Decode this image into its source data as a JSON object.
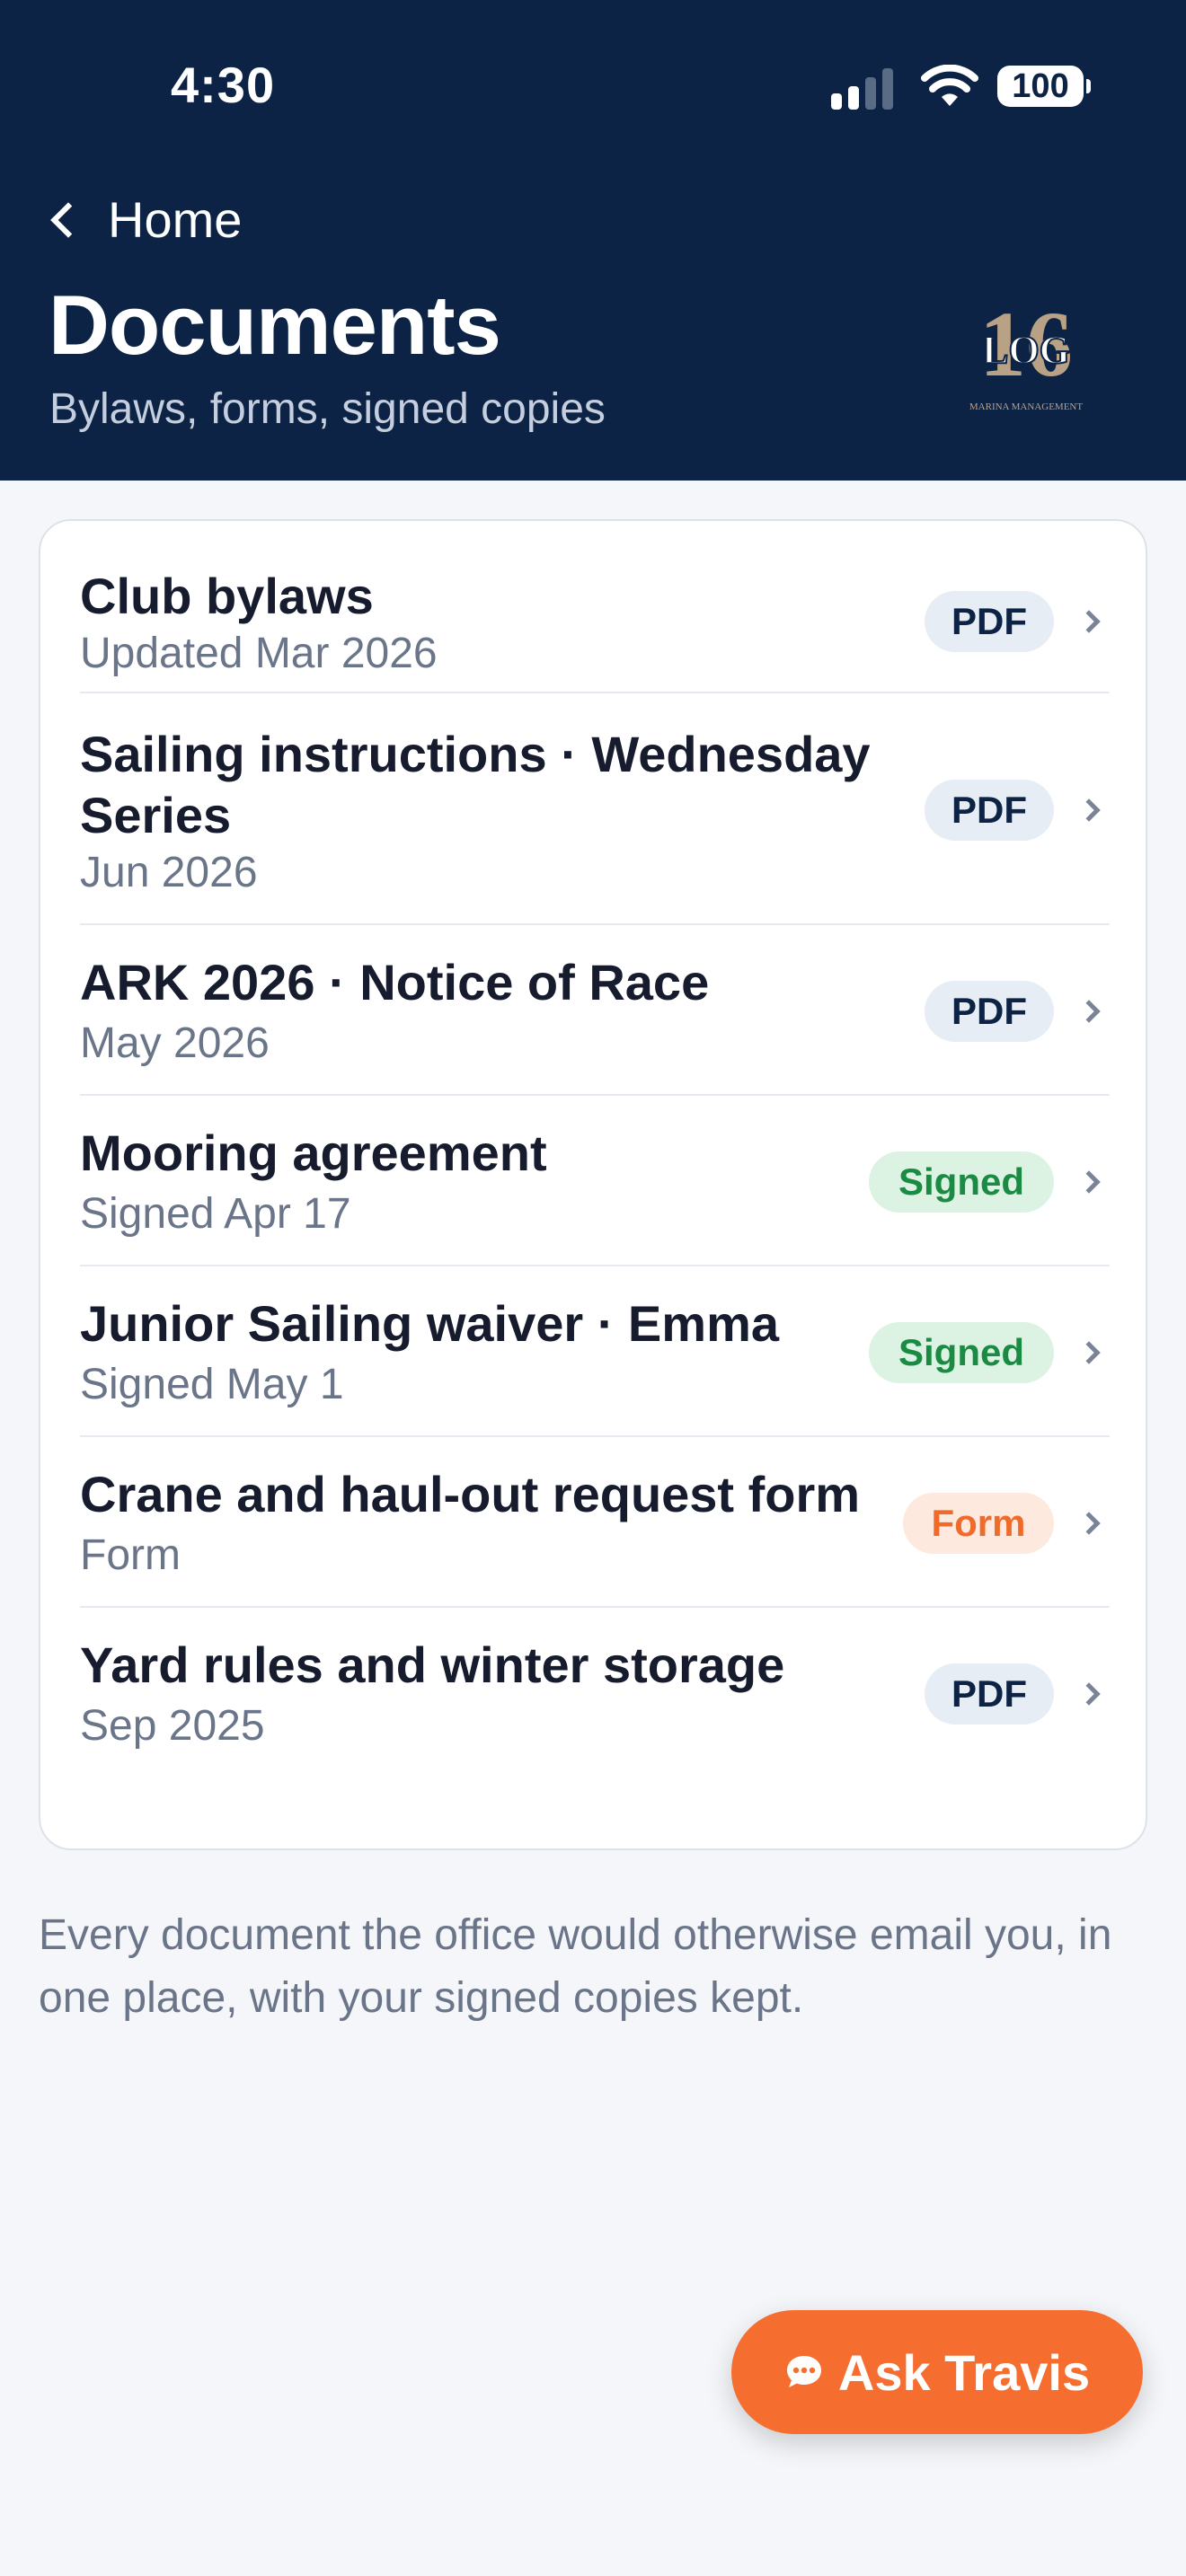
{
  "status_bar": {
    "time": "4:30",
    "battery": "100"
  },
  "header": {
    "back_label": "Home",
    "title": "Documents",
    "subtitle": "Bylaws, forms, signed copies",
    "logo": {
      "number": "16",
      "letters": "LOG",
      "tagline": "MARINA MANAGEMENT"
    }
  },
  "documents": [
    {
      "title": "Club bylaws",
      "sub": "Updated Mar 2026",
      "badge": "PDF",
      "badge_type": "pdf"
    },
    {
      "title": "Sailing instructions · Wednesday Series",
      "sub": "Jun 2026",
      "badge": "PDF",
      "badge_type": "pdf"
    },
    {
      "title": "ARK 2026 · Notice of Race",
      "sub": "May 2026",
      "badge": "PDF",
      "badge_type": "pdf"
    },
    {
      "title": "Mooring agreement",
      "sub": "Signed Apr 17",
      "badge": "Signed",
      "badge_type": "signed"
    },
    {
      "title": "Junior Sailing waiver · Emma",
      "sub": "Signed May 1",
      "badge": "Signed",
      "badge_type": "signed"
    },
    {
      "title": "Crane and haul-out request form",
      "sub": "Form",
      "badge": "Form",
      "badge_type": "form"
    },
    {
      "title": "Yard rules and winter storage",
      "sub": "Sep 2025",
      "badge": "PDF",
      "badge_type": "pdf"
    }
  ],
  "footnote": "Every document the office would otherwise email you, in one place, with your signed copies kept.",
  "ask_button": {
    "label": "Ask Travis",
    "icon": "chat-bubble-icon"
  },
  "colors": {
    "header_bg": "#0c2345",
    "accent": "#f66d30",
    "signed_green": "#1b8a43",
    "form_orange": "#f06a2a"
  }
}
